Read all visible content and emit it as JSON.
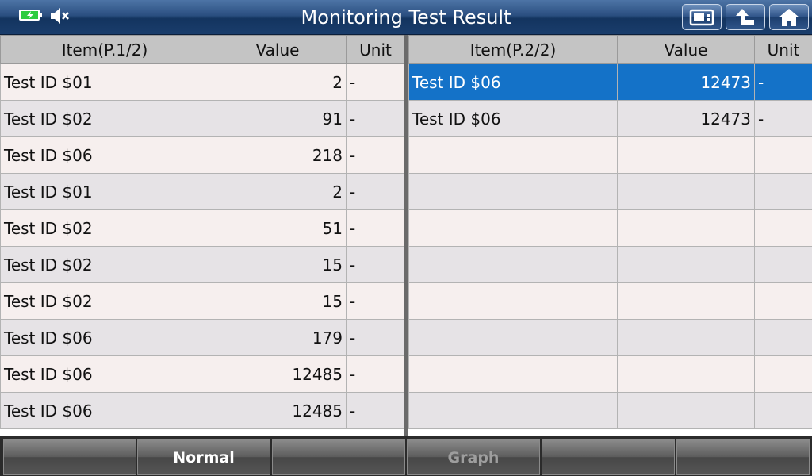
{
  "window": {
    "title": "Monitoring Test Result"
  },
  "status": {
    "battery_icon": "battery-charging-icon",
    "sound_icon": "mute-icon"
  },
  "toolbar": {
    "print_icon": "print-screen-icon",
    "back_icon": "back-arrow-icon",
    "home_icon": "home-icon"
  },
  "left_table": {
    "headers": {
      "item": "Item(P.1/2)",
      "value": "Value",
      "unit": "Unit"
    },
    "rows": [
      {
        "item": "Test ID $01",
        "value": "2",
        "unit": "-"
      },
      {
        "item": "Test ID $02",
        "value": "91",
        "unit": "-"
      },
      {
        "item": "Test ID $06",
        "value": "218",
        "unit": "-"
      },
      {
        "item": "Test ID $01",
        "value": "2",
        "unit": "-"
      },
      {
        "item": "Test ID $02",
        "value": "51",
        "unit": "-"
      },
      {
        "item": "Test ID $02",
        "value": "15",
        "unit": "-"
      },
      {
        "item": "Test ID $02",
        "value": "15",
        "unit": "-"
      },
      {
        "item": "Test ID $06",
        "value": "179",
        "unit": "-"
      },
      {
        "item": "Test ID $06",
        "value": "12485",
        "unit": "-"
      },
      {
        "item": "Test ID $06",
        "value": "12485",
        "unit": "-"
      }
    ]
  },
  "right_table": {
    "headers": {
      "item": "Item(P.2/2)",
      "value": "Value",
      "unit": "Unit"
    },
    "rows": [
      {
        "item": "Test ID $06",
        "value": "12473",
        "unit": "-"
      },
      {
        "item": "Test ID $06",
        "value": "12473",
        "unit": "-"
      },
      {
        "item": "",
        "value": "",
        "unit": ""
      },
      {
        "item": "",
        "value": "",
        "unit": ""
      },
      {
        "item": "",
        "value": "",
        "unit": ""
      },
      {
        "item": "",
        "value": "",
        "unit": ""
      },
      {
        "item": "",
        "value": "",
        "unit": ""
      },
      {
        "item": "",
        "value": "",
        "unit": ""
      },
      {
        "item": "",
        "value": "",
        "unit": ""
      },
      {
        "item": "",
        "value": "",
        "unit": ""
      }
    ]
  },
  "bottom_bar": {
    "buttons": [
      "",
      "Normal",
      "",
      "Graph",
      "",
      ""
    ]
  },
  "colors": {
    "selected_row": "#1472c8",
    "title_bar": "#1a3d6c"
  }
}
